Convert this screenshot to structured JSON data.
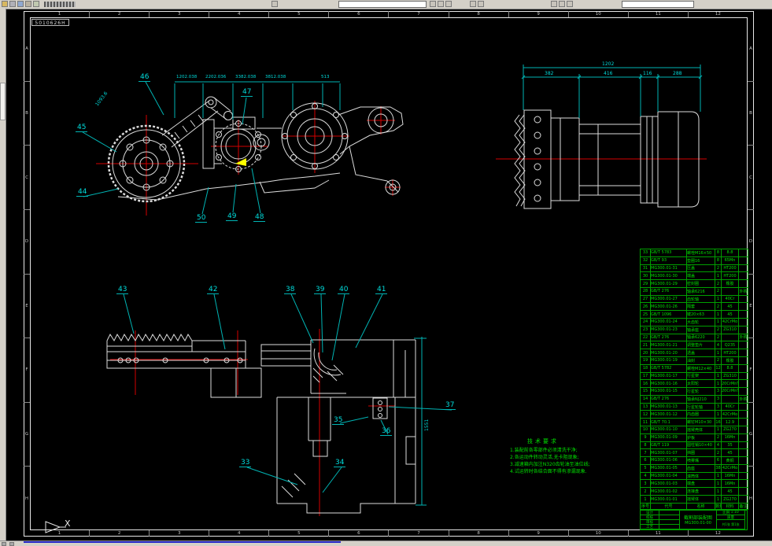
{
  "app": {
    "toolbar": {
      "icons": [
        "new-icon",
        "open-icon",
        "save-icon",
        "print-icon",
        "plot-icon"
      ],
      "combo1_value": "",
      "combo2_value": ""
    }
  },
  "sheet": {
    "stamp": "5010626H",
    "zones_top": [
      "1",
      "2",
      "3",
      "4",
      "5",
      "6",
      "7",
      "8",
      "9",
      "10",
      "11",
      "12"
    ],
    "zones_bottom": [
      "1",
      "2",
      "3",
      "4",
      "5",
      "6",
      "7",
      "8",
      "9",
      "10",
      "11",
      "12"
    ],
    "zones_left": [
      "A",
      "B",
      "C",
      "D",
      "E",
      "F",
      "G",
      "H"
    ],
    "zones_right": [
      "A",
      "B",
      "C",
      "D",
      "E",
      "F",
      "G",
      "H"
    ],
    "view_label": "X"
  },
  "view1": {
    "callouts": {
      "c44": "44",
      "c45": "45",
      "c46": "46",
      "c47": "47",
      "c48": "48",
      "c49": "49",
      "c50": "50"
    },
    "top_dims": [
      "1202.038",
      "2202.036",
      "3382.038",
      "3812.038",
      "513"
    ],
    "diag_dim": "1093.6"
  },
  "view2": {
    "total_dim": "1202",
    "seg_dims": [
      "382",
      "416",
      "116",
      "288"
    ]
  },
  "view3": {
    "callouts": {
      "c33": "33",
      "c34": "34",
      "c35": "35",
      "c36": "36",
      "c37": "37",
      "c38": "38",
      "c39": "39",
      "c40": "40",
      "c41": "41",
      "c42": "42",
      "c43": "43"
    },
    "height_dim": "1551"
  },
  "notes": {
    "title": "技术要求",
    "lines": [
      "1.装配前各零部件必须清洗干净;",
      "2.各运动件转动灵活,无卡阻现象;",
      "3.减速箱内加注N320齿轮油至油位线;",
      "4.试运转时各结合面不得有渗漏现象."
    ]
  },
  "bom": {
    "headers": [
      "序号",
      "代号",
      "名称",
      "数量",
      "材料",
      "备注"
    ],
    "rows": [
      {
        "no": "33",
        "code": "GB/T 5783",
        "name": "螺栓M16×50",
        "qty": "8",
        "mat": "8.8",
        "note": ""
      },
      {
        "no": "32",
        "code": "GB/T 93",
        "name": "垫圈16",
        "qty": "8",
        "mat": "65Mn",
        "note": ""
      },
      {
        "no": "31",
        "code": "MG300.01-31",
        "name": "压盖",
        "qty": "2",
        "mat": "HT200",
        "note": ""
      },
      {
        "no": "30",
        "code": "MG300.01-30",
        "name": "端盖",
        "qty": "1",
        "mat": "HT200",
        "note": ""
      },
      {
        "no": "29",
        "code": "MG300.01-29",
        "name": "密封圈",
        "qty": "2",
        "mat": "橡胶",
        "note": ""
      },
      {
        "no": "28",
        "code": "GB/T 276",
        "name": "轴承6216",
        "qty": "2",
        "mat": "",
        "note": "外购"
      },
      {
        "no": "27",
        "code": "MG300.01-27",
        "name": "齿轮轴",
        "qty": "1",
        "mat": "40Cr",
        "note": ""
      },
      {
        "no": "26",
        "code": "MG300.01-26",
        "name": "隔套",
        "qty": "2",
        "mat": "45",
        "note": ""
      },
      {
        "no": "25",
        "code": "GB/T 1096",
        "name": "键20×63",
        "qty": "1",
        "mat": "45",
        "note": ""
      },
      {
        "no": "24",
        "code": "MG300.01-24",
        "name": "大齿轮",
        "qty": "1",
        "mat": "42CrMo",
        "note": ""
      },
      {
        "no": "23",
        "code": "MG300.01-23",
        "name": "轴承座",
        "qty": "2",
        "mat": "ZG310",
        "note": ""
      },
      {
        "no": "22",
        "code": "GB/T 276",
        "name": "轴承6220",
        "qty": "2",
        "mat": "",
        "note": "外购"
      },
      {
        "no": "21",
        "code": "MG300.01-21",
        "name": "调整垫片",
        "qty": "4",
        "mat": "Q235",
        "note": ""
      },
      {
        "no": "20",
        "code": "MG300.01-20",
        "name": "透盖",
        "qty": "1",
        "mat": "HT200",
        "note": ""
      },
      {
        "no": "19",
        "code": "MG300.01-19",
        "name": "油封",
        "qty": "2",
        "mat": "橡胶",
        "note": ""
      },
      {
        "no": "18",
        "code": "GB/T 5782",
        "name": "螺栓M12×40",
        "qty": "12",
        "mat": "8.8",
        "note": ""
      },
      {
        "no": "17",
        "code": "MG300.01-17",
        "name": "行星架",
        "qty": "1",
        "mat": "ZG310",
        "note": ""
      },
      {
        "no": "16",
        "code": "MG300.01-16",
        "name": "太阳轮",
        "qty": "1",
        "mat": "20CrMnTi",
        "note": ""
      },
      {
        "no": "15",
        "code": "MG300.01-15",
        "name": "行星轮",
        "qty": "3",
        "mat": "20CrMnTi",
        "note": ""
      },
      {
        "no": "14",
        "code": "GB/T 276",
        "name": "轴承NJ210",
        "qty": "3",
        "mat": "",
        "note": "外购"
      },
      {
        "no": "13",
        "code": "MG300.01-13",
        "name": "行星轮轴",
        "qty": "3",
        "mat": "40Cr",
        "note": ""
      },
      {
        "no": "12",
        "code": "MG300.01-12",
        "name": "内齿圈",
        "qty": "1",
        "mat": "42CrMo",
        "note": ""
      },
      {
        "no": "11",
        "code": "GB/T 70.1",
        "name": "螺钉M10×30",
        "qty": "16",
        "mat": "12.9",
        "note": ""
      },
      {
        "no": "10",
        "code": "MG300.01-10",
        "name": "摇臂壳体",
        "qty": "1",
        "mat": "ZG270",
        "note": ""
      },
      {
        "no": "9",
        "code": "MG300.01-09",
        "name": "护板",
        "qty": "2",
        "mat": "16Mn",
        "note": ""
      },
      {
        "no": "8",
        "code": "GB/T 119",
        "name": "圆柱销10×40",
        "qty": "4",
        "mat": "35",
        "note": ""
      },
      {
        "no": "7",
        "code": "MG300.01-07",
        "name": "挡圈",
        "qty": "2",
        "mat": "45",
        "note": ""
      },
      {
        "no": "6",
        "code": "MG300.01-06",
        "name": "喷雾嘴",
        "qty": "6",
        "mat": "黄铜",
        "note": ""
      },
      {
        "no": "5",
        "code": "MG300.01-05",
        "name": "齿座",
        "qty": "38",
        "mat": "42CrMo",
        "note": ""
      },
      {
        "no": "4",
        "code": "MG300.01-04",
        "name": "滚筒体",
        "qty": "1",
        "mat": "16Mn",
        "note": ""
      },
      {
        "no": "3",
        "code": "MG300.01-03",
        "name": "端盘",
        "qty": "1",
        "mat": "16Mn",
        "note": ""
      },
      {
        "no": "2",
        "code": "MG300.01-02",
        "name": "连接盘",
        "qty": "1",
        "mat": "45",
        "note": ""
      },
      {
        "no": "1",
        "code": "MG300.01-01",
        "name": "摇臂体",
        "qty": "1",
        "mat": "ZG270",
        "note": ""
      }
    ]
  },
  "title_block": {
    "rows_left": [
      "设计",
      "校核",
      "审核",
      "工艺"
    ],
    "name": "截割部装配图",
    "code": "MG300.01-00",
    "scale_label": "比例",
    "scale": "1:10",
    "mass_label": "质量",
    "sheet": "共1张 第1张"
  }
}
